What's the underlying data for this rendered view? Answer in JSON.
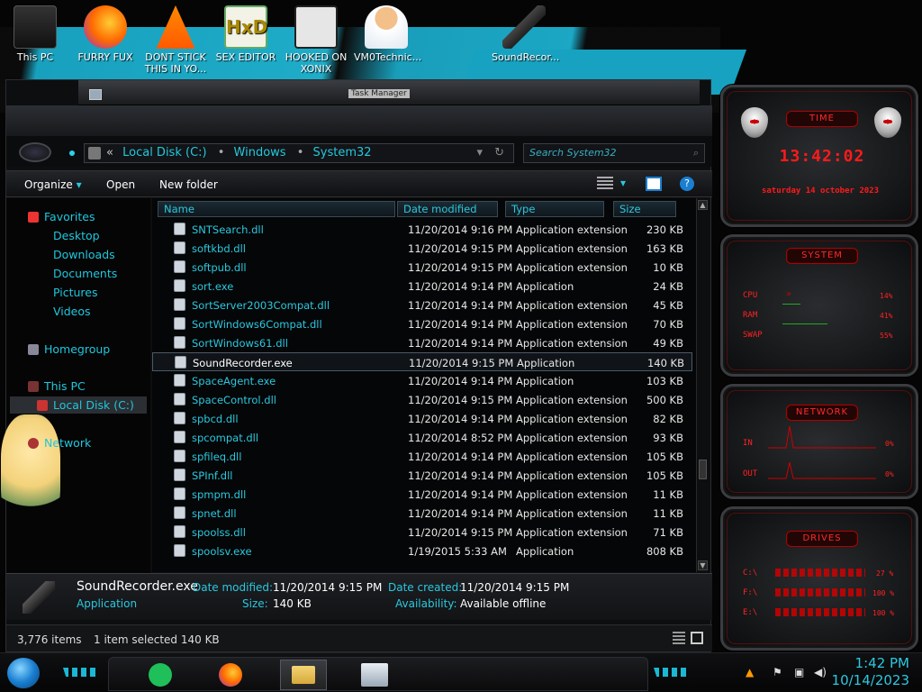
{
  "desktop": {
    "icons": [
      {
        "label": "This PC",
        "icon": "computer-icon"
      },
      {
        "label": "FURRY FUX",
        "icon": "firefox-shortcut-icon"
      },
      {
        "label": "DONT STICK THIS IN YO...",
        "icon": "vlc-shortcut-icon"
      },
      {
        "label": "SEX EDITOR",
        "icon": "hxd-shortcut-icon"
      },
      {
        "label": "HOOKED ON XONIX",
        "icon": "xonix-shortcut-icon"
      },
      {
        "label": "VM0Technic...",
        "icon": "technician-icon"
      },
      {
        "label": "SoundRecor...",
        "icon": "microphone-icon"
      }
    ]
  },
  "window": {
    "title": "Task Manager",
    "address": [
      "Local Disk (C:)",
      "Windows",
      "System32"
    ],
    "search_placeholder": "Search System32"
  },
  "toolbar": {
    "organize": "Organize",
    "open": "Open",
    "new_folder": "New folder"
  },
  "nav": {
    "favorites": "Favorites",
    "desktop": "Desktop",
    "downloads": "Downloads",
    "documents": "Documents",
    "pictures": "Pictures",
    "videos": "Videos",
    "homegroup": "Homegroup",
    "this_pc": "This PC",
    "local_disk": "Local Disk (C:)",
    "network": "Network"
  },
  "columns": {
    "name": "Name",
    "date": "Date modified",
    "type": "Type",
    "size": "Size"
  },
  "files": [
    {
      "name": "SNTSearch.dll",
      "date": "11/20/2014 9:16 PM",
      "type": "Application extension",
      "size": "230 KB"
    },
    {
      "name": "softkbd.dll",
      "date": "11/20/2014 9:15 PM",
      "type": "Application extension",
      "size": "163 KB"
    },
    {
      "name": "softpub.dll",
      "date": "11/20/2014 9:15 PM",
      "type": "Application extension",
      "size": "10 KB"
    },
    {
      "name": "sort.exe",
      "date": "11/20/2014 9:14 PM",
      "type": "Application",
      "size": "24 KB"
    },
    {
      "name": "SortServer2003Compat.dll",
      "date": "11/20/2014 9:14 PM",
      "type": "Application extension",
      "size": "45 KB"
    },
    {
      "name": "SortWindows6Compat.dll",
      "date": "11/20/2014 9:14 PM",
      "type": "Application extension",
      "size": "70 KB"
    },
    {
      "name": "SortWindows61.dll",
      "date": "11/20/2014 9:14 PM",
      "type": "Application extension",
      "size": "49 KB"
    },
    {
      "name": "SoundRecorder.exe",
      "date": "11/20/2014 9:15 PM",
      "type": "Application",
      "size": "140 KB"
    },
    {
      "name": "SpaceAgent.exe",
      "date": "11/20/2014 9:14 PM",
      "type": "Application",
      "size": "103 KB"
    },
    {
      "name": "SpaceControl.dll",
      "date": "11/20/2014 9:15 PM",
      "type": "Application extension",
      "size": "500 KB"
    },
    {
      "name": "spbcd.dll",
      "date": "11/20/2014 9:14 PM",
      "type": "Application extension",
      "size": "82 KB"
    },
    {
      "name": "spcompat.dll",
      "date": "11/20/2014 8:52 PM",
      "type": "Application extension",
      "size": "93 KB"
    },
    {
      "name": "spfileq.dll",
      "date": "11/20/2014 9:14 PM",
      "type": "Application extension",
      "size": "105 KB"
    },
    {
      "name": "SPInf.dll",
      "date": "11/20/2014 9:14 PM",
      "type": "Application extension",
      "size": "105 KB"
    },
    {
      "name": "spmpm.dll",
      "date": "11/20/2014 9:14 PM",
      "type": "Application extension",
      "size": "11 KB"
    },
    {
      "name": "spnet.dll",
      "date": "11/20/2014 9:14 PM",
      "type": "Application extension",
      "size": "11 KB"
    },
    {
      "name": "spoolss.dll",
      "date": "11/20/2014 9:15 PM",
      "type": "Application extension",
      "size": "71 KB"
    },
    {
      "name": "spoolsv.exe",
      "date": "1/19/2015 5:33 AM",
      "type": "Application",
      "size": "808 KB"
    }
  ],
  "selected_index": 7,
  "details": {
    "name": "SoundRecorder.exe",
    "kind": "Application",
    "date_modified_label": "Date modified:",
    "date_modified": "11/20/2014 9:15 PM",
    "size_label": "Size:",
    "size": "140 KB",
    "date_created_label": "Date created:",
    "date_created": "11/20/2014 9:15 PM",
    "availability_label": "Availability:",
    "availability": "Available offline"
  },
  "status": {
    "items": "3,776 items",
    "selected": "1 item selected  140 KB"
  },
  "gadgets": {
    "time": {
      "title": "TIME",
      "clock": "13:42:02",
      "date": "saturday 14 october 2023"
    },
    "system": {
      "title": "SYSTEM",
      "cpu_label": "CPU",
      "cpu": "14%",
      "ram_label": "RAM",
      "ram": "41%",
      "swap_label": "SWAP",
      "swap": "55%"
    },
    "network": {
      "title": "NETWORK",
      "in_label": "IN",
      "in": "0%",
      "out_label": "OUT",
      "out": "0%"
    },
    "drives": {
      "title": "DRIVES",
      "c_label": "C:\\",
      "c": "27 %",
      "f_label": "F:\\",
      "f": "100 %",
      "e_label": "E:\\",
      "e": "100 %"
    }
  },
  "taskbar": {
    "time": "1:42 PM",
    "date": "10/14/2023"
  },
  "colors": {
    "accent": "#2bc8df",
    "gadget_red": "#ff2222"
  }
}
